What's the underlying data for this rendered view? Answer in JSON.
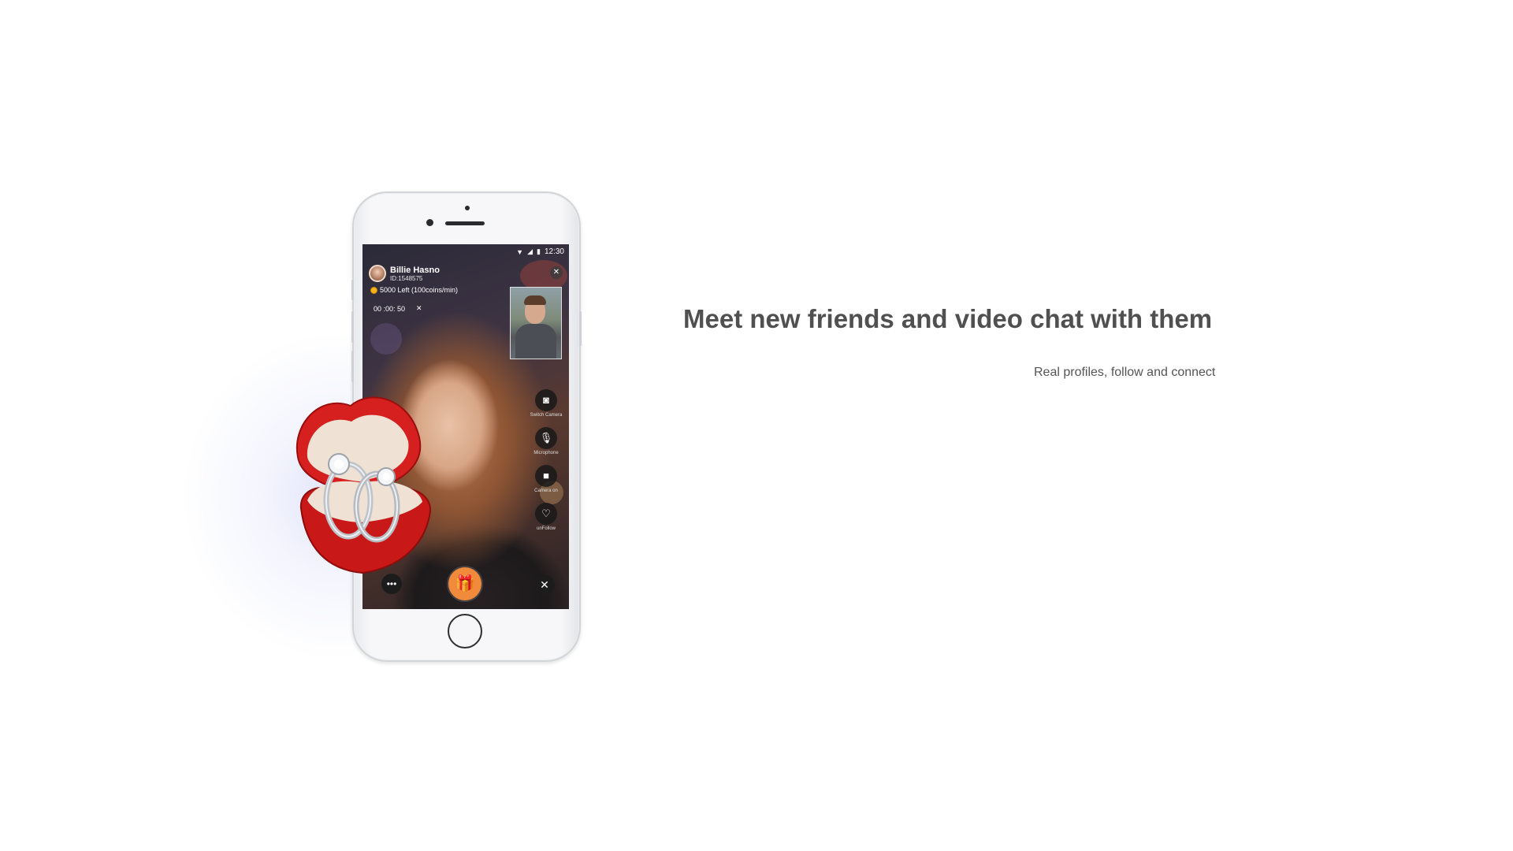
{
  "headline": "Meet new friends and video chat with them",
  "subline": "Real profiles, follow and connect",
  "phone": {
    "status_time": "12:30",
    "user_name": "Billie Hasno",
    "user_id": "ID:1548575",
    "coins_text": "5000 Left (100coins/min)",
    "timer": "00 :00: 50",
    "controls": [
      {
        "icon": "camera-icon",
        "glyph": "◙",
        "label": "Switch Camera"
      },
      {
        "icon": "microphone-icon",
        "glyph": "🎙",
        "label": "Microphone"
      },
      {
        "icon": "video-icon",
        "glyph": "■",
        "label": "Camera on"
      },
      {
        "icon": "heart-icon",
        "glyph": "♡",
        "label": "unFollow"
      }
    ]
  },
  "colors": {
    "gift_button": "#f28a3c",
    "headline": "#505050",
    "ring_box": "#d61f1f"
  }
}
